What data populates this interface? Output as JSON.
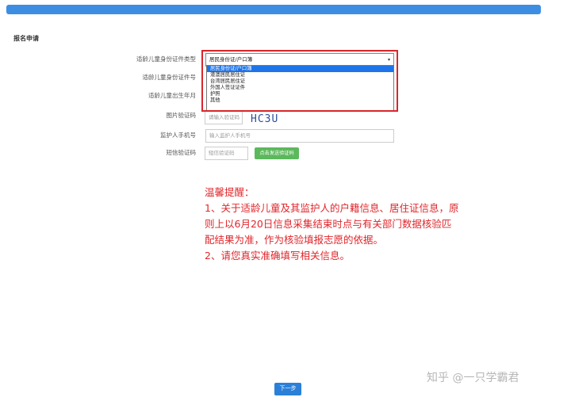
{
  "section_title": "报名申请",
  "form": {
    "id_type_label": "适龄儿童身份证件类型",
    "id_type_value": "居民身份证/户口簿",
    "id_type_caret": "▾",
    "id_number_label": "适龄儿童身份证件号",
    "birth_label": "适龄儿童出生年月",
    "captcha_label": "图片验证码",
    "captcha_placeholder": "请输入验证码",
    "captcha_text": "HC3U",
    "phone_label": "监护人手机号",
    "phone_placeholder": "输入监护人手机号",
    "sms_label": "短信验证码",
    "sms_placeholder": "短信验证码",
    "sms_button": "点击发送验证码"
  },
  "dropdown": {
    "options": [
      "居民身份证/户口簿",
      "港澳居民居住证",
      "台湾居民居住证",
      "外国人签证证件",
      "护照",
      "其他"
    ],
    "selected_index": 0
  },
  "notice": {
    "heading": "温馨提醒：",
    "line1": "1、关于适龄儿童及其监护人的户籍信息、居住证信息，原",
    "line2": "则上以6月20日信息采集结束时点与有关部门数据核验匹",
    "line3": "配结果为准，作为核验填报志愿的依据。",
    "line4": "2、请您真实准确填写相关信息。"
  },
  "next_button": "下一步",
  "watermark": "知乎 @一只学霸君",
  "colors": {
    "topbar": "#3d8de3",
    "highlight": "#d9262b",
    "selected_option": "#1e73e8",
    "sms_button": "#5cb85c",
    "next_button": "#2a80d8",
    "notice_text": "#e0262b"
  }
}
